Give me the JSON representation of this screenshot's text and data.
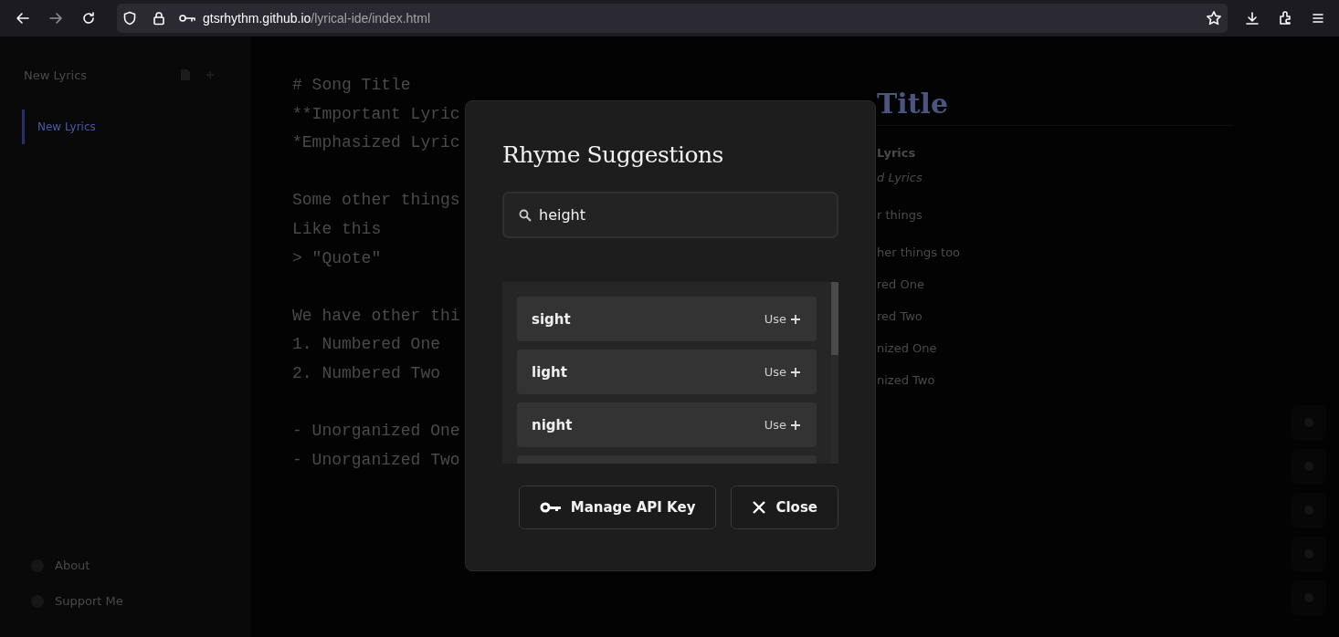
{
  "browser": {
    "url_host": "gtsrhythm.github.io",
    "url_path": "/lyrical-ide/index.html"
  },
  "sidebar": {
    "title": "New Lyrics",
    "items": [
      {
        "label": "New Lyrics",
        "selected": true
      }
    ],
    "footer": [
      {
        "label": "About"
      },
      {
        "label": "Support Me"
      }
    ]
  },
  "editor": {
    "blocks": [
      [
        "# Song Title",
        "**Important Lyric",
        "*Emphasized Lyric"
      ],
      [
        "Some other things",
        "Like this",
        "> \"Quote\""
      ],
      [
        "We have other thi",
        "1. Numbered One",
        "2. Numbered Two"
      ],
      [
        "- Unorganized One",
        "- Unorganized Two"
      ]
    ]
  },
  "preview": [
    {
      "kind": "heading",
      "text": "Title"
    },
    {
      "kind": "bold",
      "text": "Lyrics"
    },
    {
      "kind": "italic",
      "text": "d Lyrics"
    },
    {
      "kind": "para",
      "text": "r things"
    },
    {
      "kind": "para",
      "text": "her things too"
    },
    {
      "kind": "list",
      "text": "red One"
    },
    {
      "kind": "list",
      "text": "red Two"
    },
    {
      "kind": "list",
      "text": "nized One"
    },
    {
      "kind": "list",
      "text": "nized Two"
    }
  ],
  "modal": {
    "title": "Rhyme Suggestions",
    "search": {
      "value": "height"
    },
    "suggestions": [
      {
        "word": "sight",
        "action": "Use"
      },
      {
        "word": "light",
        "action": "Use"
      },
      {
        "word": "night",
        "action": "Use"
      }
    ],
    "more_below": true,
    "buttons": [
      {
        "kind": "key",
        "label": "Manage API Key"
      },
      {
        "kind": "close",
        "label": "Close"
      }
    ]
  }
}
